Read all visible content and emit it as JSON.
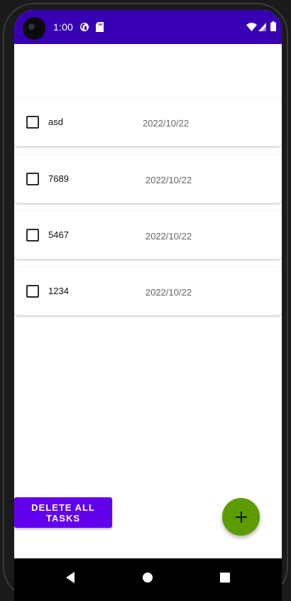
{
  "status_bar": {
    "time": "1:00",
    "background_color": "#3700b3",
    "left_icons": [
      "camera-icon",
      "sync-app-icon",
      "sd-card-icon"
    ],
    "right_icons": [
      "wifi-icon",
      "signal-icon",
      "battery-icon"
    ]
  },
  "tasks": [
    {
      "title": "asd",
      "date": "2022/10/22",
      "checked": false
    },
    {
      "title": "7689",
      "date": "2022/10/22",
      "checked": false
    },
    {
      "title": "5467",
      "date": "2022/10/22",
      "checked": false
    },
    {
      "title": "1234",
      "date": "2022/10/22",
      "checked": false
    }
  ],
  "delete_button": {
    "label": "DELETE ALL TASKS",
    "color": "#6200ee"
  },
  "fab": {
    "icon": "plus-icon",
    "color": "#5d9c00"
  },
  "nav_bar": {
    "buttons": [
      "back-icon",
      "home-icon",
      "recents-icon"
    ]
  }
}
